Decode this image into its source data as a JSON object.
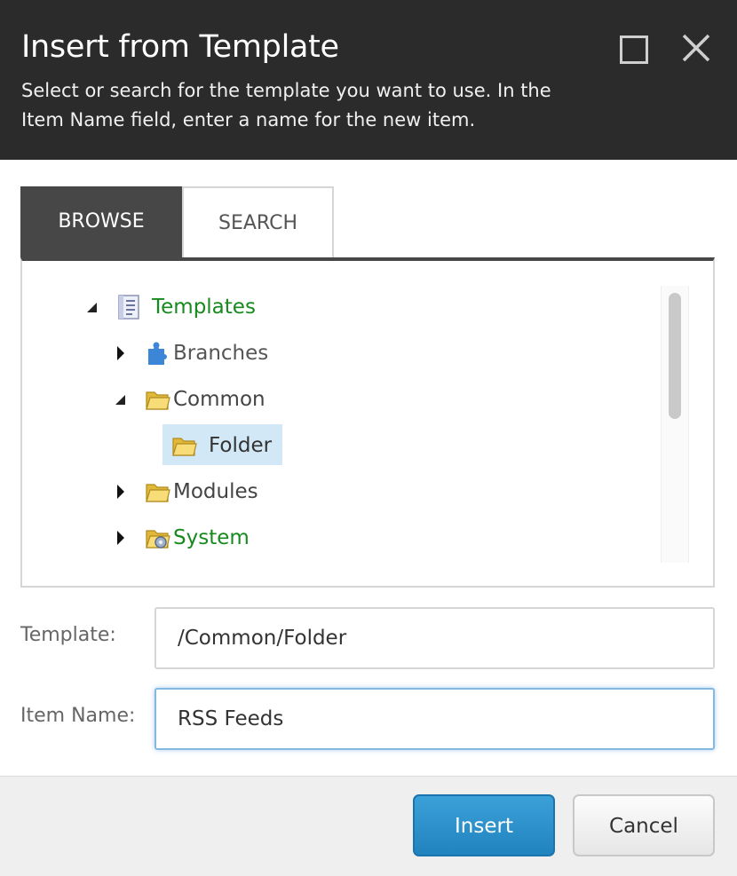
{
  "dialog": {
    "title": "Insert from Template",
    "subtitle": "Select or search for the template you want to use. In the Item Name field, enter a name for the new item."
  },
  "tabs": [
    {
      "label": "BROWSE",
      "active": true
    },
    {
      "label": "SEARCH",
      "active": false
    }
  ],
  "tree": {
    "items": [
      {
        "label": "Templates",
        "expanded": true,
        "icon": "template-doc-icon",
        "color": "#168a1c"
      },
      {
        "label": "Branches",
        "expanded": false,
        "icon": "puzzle-icon",
        "color": "#555555"
      },
      {
        "label": "Common",
        "expanded": true,
        "icon": "folder-icon",
        "color": "#555555"
      },
      {
        "label": "Folder",
        "selected": true,
        "icon": "folder-icon",
        "color": "#333333"
      },
      {
        "label": "Modules",
        "expanded": false,
        "icon": "folder-icon",
        "color": "#555555"
      },
      {
        "label": "System",
        "expanded": false,
        "icon": "system-folder-icon",
        "color": "#168a1c"
      }
    ]
  },
  "form": {
    "template_label": "Template:",
    "template_value": "/Common/Folder",
    "item_name_label": "Item Name:",
    "item_name_value": "RSS Feeds"
  },
  "buttons": {
    "insert": "Insert",
    "cancel": "Cancel"
  },
  "colors": {
    "header_bg": "#2b2b2b",
    "accent_green": "#168a1c",
    "selected_bg": "#d3e8f6",
    "primary_button": "#2083bf"
  }
}
